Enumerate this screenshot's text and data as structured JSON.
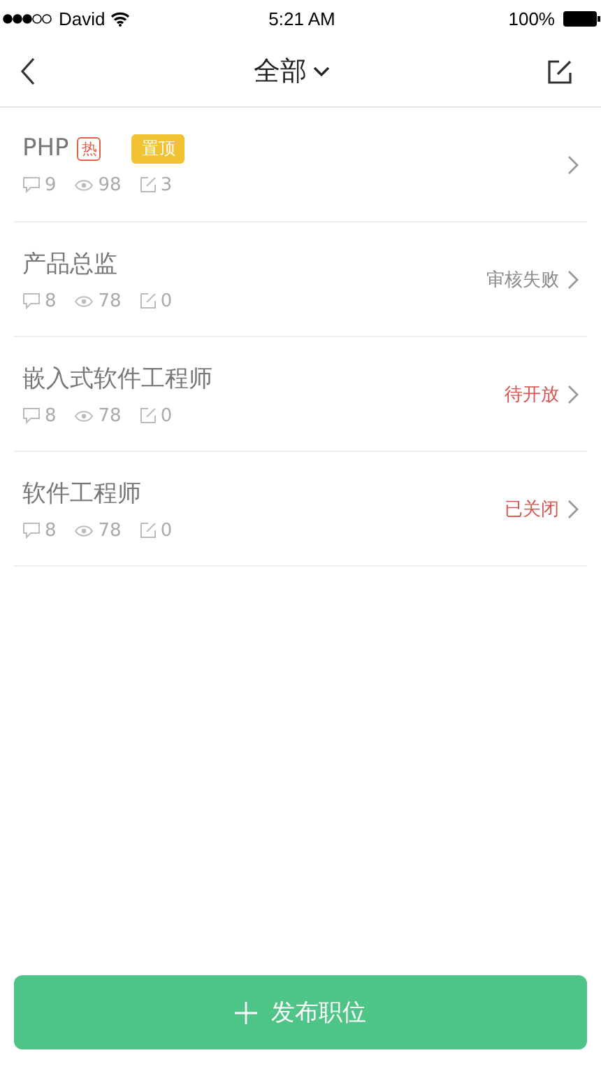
{
  "status_bar": {
    "carrier": "David",
    "time": "5:21 AM",
    "battery": "100%"
  },
  "nav": {
    "title": "全部"
  },
  "jobs": [
    {
      "title": "PHP",
      "hot": true,
      "hot_label": "热",
      "pinned": true,
      "pinned_label": "置顶",
      "comments": "9",
      "views": "98",
      "edits": "3"
    },
    {
      "title": "产品总监",
      "hot": false,
      "pinned": false,
      "comments": "8",
      "views": "78",
      "edits": "0",
      "status": "审核失败",
      "color": "#8a8a8a"
    },
    {
      "title": "嵌入式软件工程师",
      "hot": false,
      "pinned": false,
      "comments": "8",
      "views": "78",
      "edits": "0",
      "status": "待开放",
      "color": "#d9534f"
    },
    {
      "title": "软件工程师",
      "hot": false,
      "pinned": false,
      "comments": "8",
      "views": "78",
      "edits": "0",
      "status": "已关闭",
      "color": "#d9534f"
    }
  ],
  "publish_button": {
    "label": "发布职位"
  }
}
